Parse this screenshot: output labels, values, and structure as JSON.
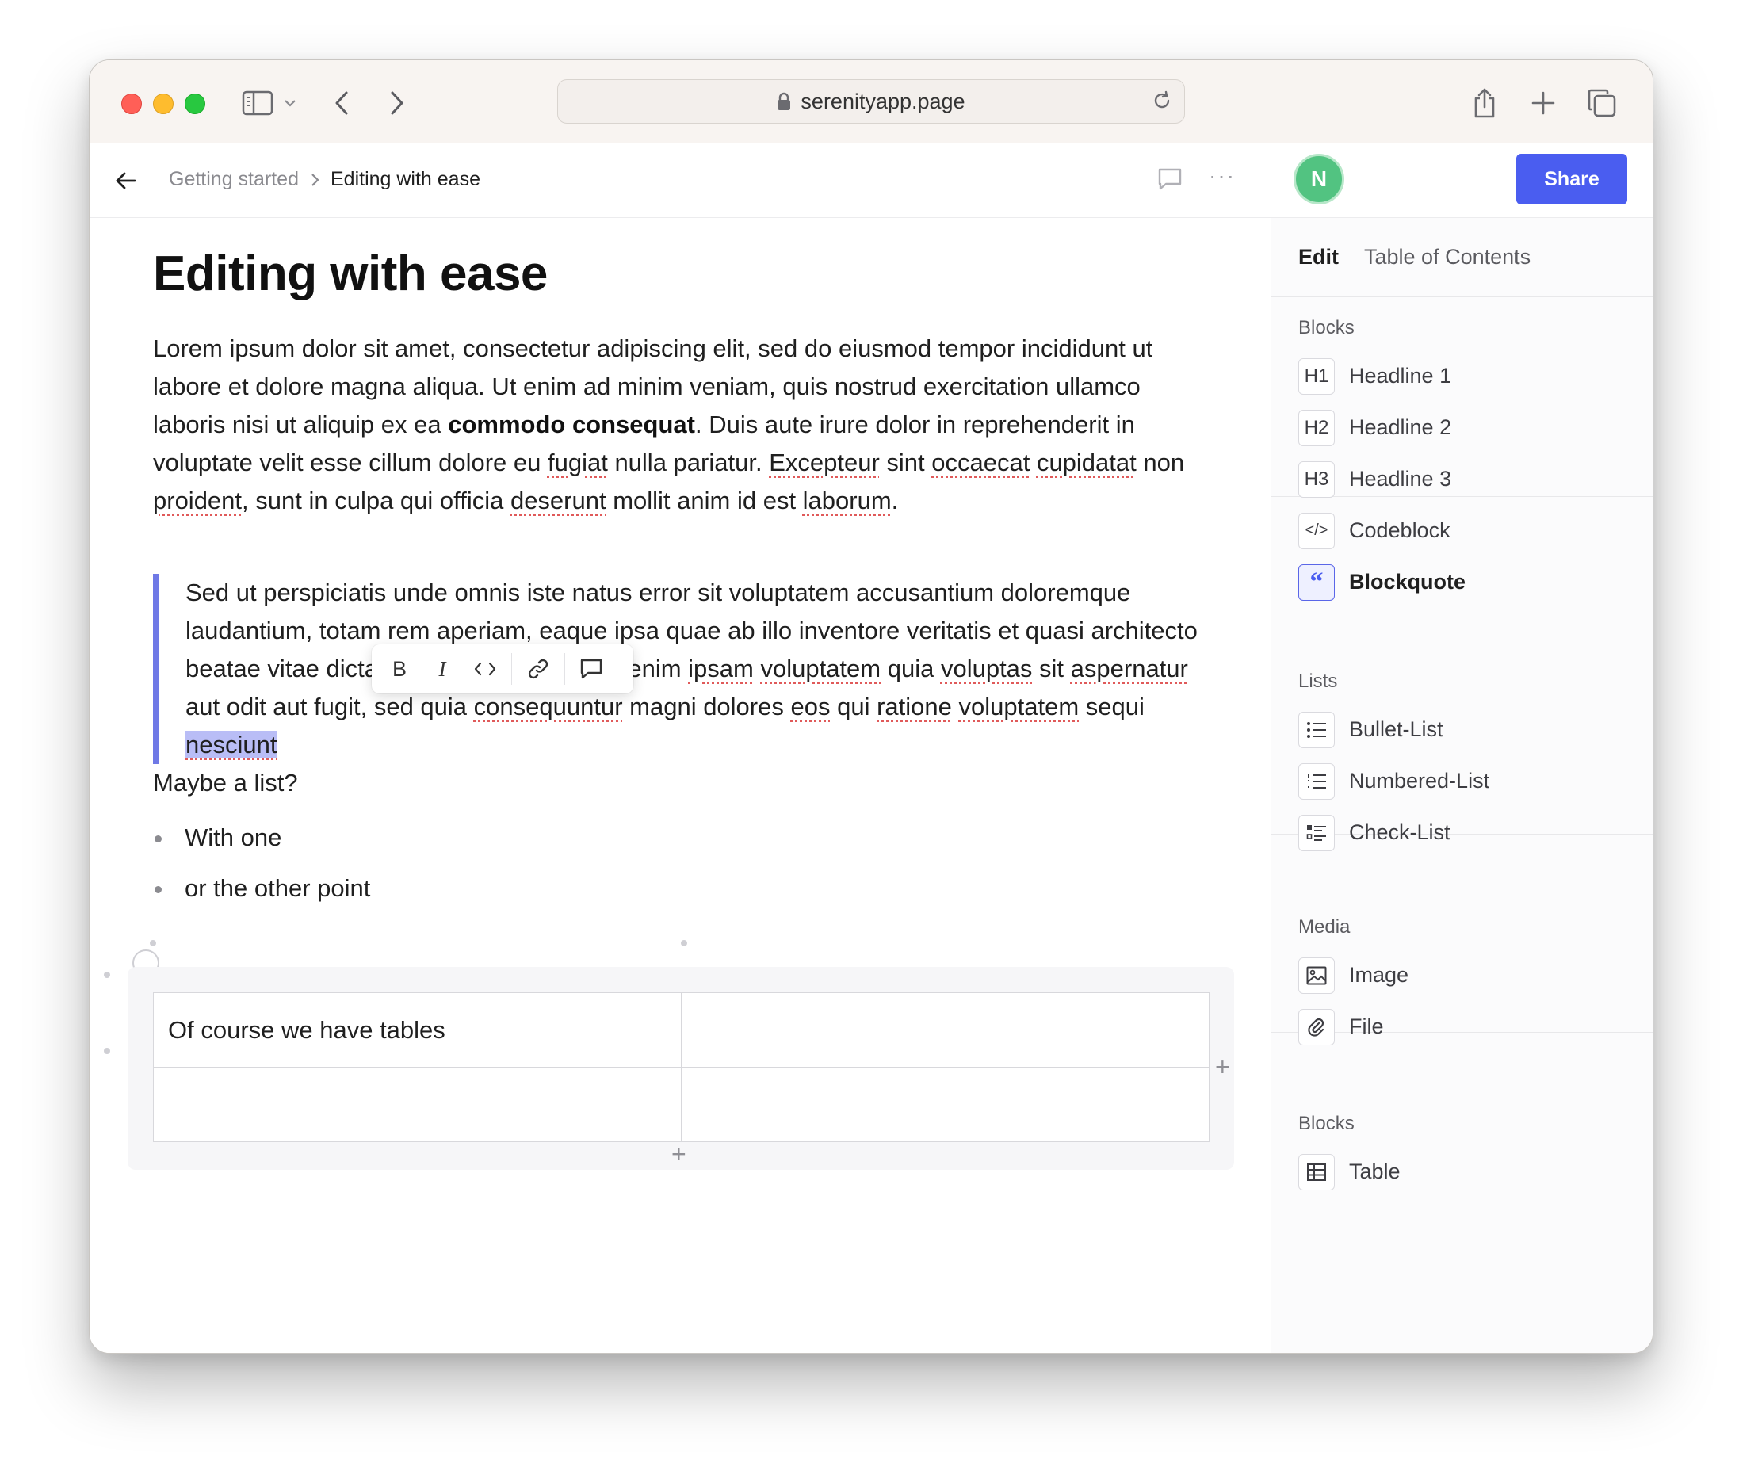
{
  "browser": {
    "url": "serenityapp.page"
  },
  "header": {
    "breadcrumb": [
      "Getting started",
      "Editing with ease"
    ],
    "more": "···"
  },
  "doc": {
    "title": "Editing with ease",
    "paragraph": {
      "p1": "Lorem ipsum dolor sit amet, consectetur adipiscing elit, sed do eiusmod tempor incididunt ut labore et dolore magna aliqua. Ut enim ad minim veniam, quis nostrud exercitation ullamco laboris nisi ut aliquip ex ea ",
      "bold": "commodo consequat",
      "p2": ". Duis aute irure dolor in reprehenderit in voluptate velit esse cillum dolore eu ",
      "w_fugiat": "fugiat",
      "p3": " nulla pariatur. ",
      "w_excepteur": "Excepteur",
      "p4": " sint ",
      "w_occaecat": "occaecat",
      "p5": " ",
      "w_cupidatat": "cupidatat",
      "p6": " non ",
      "w_proident": "proident",
      "p7": ", sunt in culpa qui officia ",
      "w_deserunt": "deserunt",
      "p8": " mollit anim id est ",
      "w_laborum": "laborum",
      "p9": "."
    },
    "quote": {
      "q1": "Sed ut perspiciatis unde omnis iste natus error sit voluptatem accusantium doloremque laudantium, totam rem aperiam, eaque ipsa quae ab illo inventore veritatis et quasi architecto beatae vitae dicta sunt explicabo. Nemo enim ",
      "w_ipsam": "ipsam",
      "q2": " ",
      "w_voluptatem": "voluptatem",
      "q3": " quia ",
      "w_voluptas": "voluptas",
      "q4": " sit ",
      "w_aspernatur": "aspernatur",
      "q5": " aut odit aut fugit, sed quia ",
      "w_consequuntur": "consequuntur",
      "q6": " magni dolores ",
      "w_eos": "eos",
      "q7": " qui ",
      "w_ratione": "ratione",
      "q8": " ",
      "w_voluptatem2": "voluptatem",
      "q9": " sequi ",
      "w_selected": "nesciunt"
    },
    "toolbar": {
      "bold": "B",
      "italic": "I",
      "code": "‹›"
    },
    "list_intro": "Maybe a list?",
    "bullets": [
      "With one",
      "or the other point"
    ],
    "table": {
      "rows": [
        [
          "Of course we have tables",
          ""
        ],
        [
          "",
          ""
        ]
      ],
      "add": "+"
    }
  },
  "sidebar": {
    "avatar_initial": "N",
    "share_label": "Share",
    "tabs": [
      "Edit",
      "Table of Contents"
    ],
    "sections": [
      {
        "title": "Blocks",
        "items": [
          {
            "icon": "H1",
            "label": "Headline 1"
          },
          {
            "icon": "H2",
            "label": "Headline 2"
          },
          {
            "icon": "H3",
            "label": "Headline 3"
          },
          {
            "icon": "</>",
            "label": "Codeblock"
          },
          {
            "icon": "“",
            "label": "Blockquote"
          }
        ]
      },
      {
        "title": "Lists",
        "items": [
          {
            "icon": "bullet-list-icon",
            "label": "Bullet-List"
          },
          {
            "icon": "numbered-list-icon",
            "label": "Numbered-List"
          },
          {
            "icon": "check-list-icon",
            "label": "Check-List"
          }
        ]
      },
      {
        "title": "Media",
        "items": [
          {
            "icon": "image-icon",
            "label": "Image"
          },
          {
            "icon": "paperclip-icon",
            "label": "File"
          }
        ]
      },
      {
        "title": "Blocks",
        "items": [
          {
            "icon": "table-icon",
            "label": "Table"
          }
        ]
      }
    ]
  },
  "colors": {
    "accent": "#4a5df0",
    "quote_bar": "#6f79e6",
    "selection": "#b9bdf6",
    "avatar": "#52c381",
    "spellcheck": "#e05a5a"
  }
}
